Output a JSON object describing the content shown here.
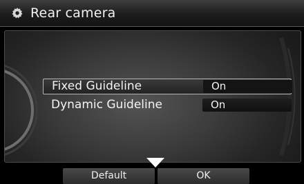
{
  "header": {
    "title": "Rear camera",
    "icon": "gear-icon"
  },
  "settings": [
    {
      "label": "Fixed Guideline",
      "value": "On",
      "selected": true
    },
    {
      "label": "Dynamic Guideline",
      "value": "On",
      "selected": false
    }
  ],
  "scroll": {
    "icon": "down-arrow-icon"
  },
  "buttons": {
    "default_label": "Default",
    "ok_label": "OK"
  }
}
